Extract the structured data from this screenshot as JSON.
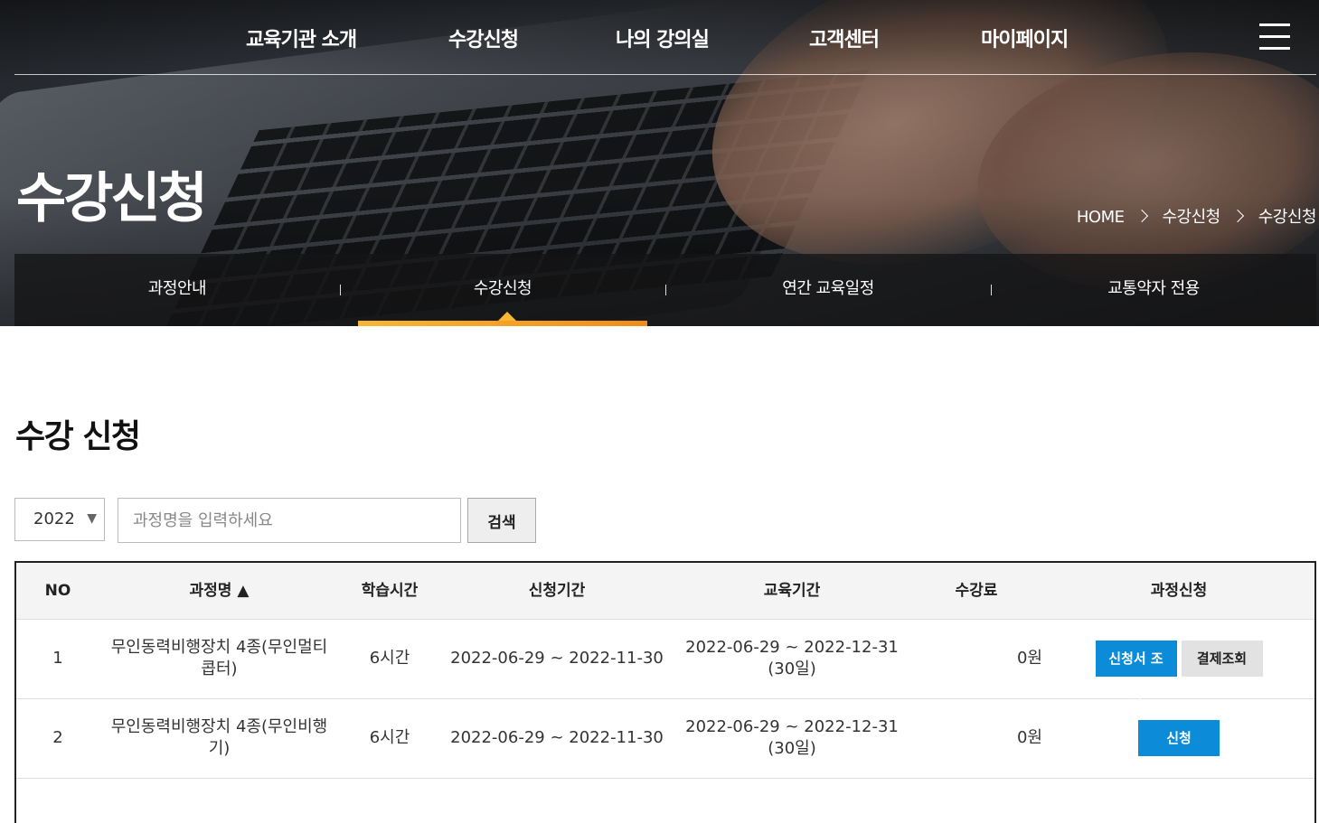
{
  "topnav": {
    "items": [
      "교육기관 소개",
      "수강신청",
      "나의 강의실",
      "고객센터",
      "마이페이지"
    ],
    "menu_icon": "hamburger-menu-icon"
  },
  "hero": {
    "title": "수강신청",
    "breadcrumb": [
      "HOME",
      "수강신청",
      "수강신청"
    ]
  },
  "subnav": {
    "items": [
      "과정안내",
      "수강신청",
      "연간 교육일정",
      "교통약자 전용"
    ],
    "active_index": 1,
    "active_color": "#f7a72a"
  },
  "main": {
    "heading": "수강 신청",
    "year_select": {
      "value": "2022",
      "arrow": "▼"
    },
    "search": {
      "placeholder": "과정명을 입력하세요",
      "button": "검색"
    },
    "table": {
      "headers": [
        "NO",
        "과정명 ▲",
        "학습시간",
        "신청기간",
        "교육기간",
        "수강료",
        "과정신청"
      ],
      "rows": [
        {
          "no": "1",
          "course_line1": "무인동력비행장치 4종(무인멀티",
          "course_line2": "콥터)",
          "hours": "6시간",
          "apply_period": "2022-06-29 ~ 2022-11-30",
          "edu_line1": "2022-06-29 ~ 2022-12-31",
          "edu_line2": "(30일)",
          "fee": "0원",
          "btn_primary": "신청서 조회",
          "btn_secondary": "결제조회"
        },
        {
          "no": "2",
          "course_line1": "무인동력비행장치 4종(무인비행",
          "course_line2": "기)",
          "hours": "6시간",
          "apply_period": "2022-06-29 ~ 2022-11-30",
          "edu_line1": "2022-06-29 ~ 2022-12-31",
          "edu_line2": "(30일)",
          "fee": "0원",
          "btn_primary": "신청"
        }
      ]
    }
  },
  "colors": {
    "primary_button": "#0c8bd8",
    "secondary_button": "#e2e2e2"
  }
}
